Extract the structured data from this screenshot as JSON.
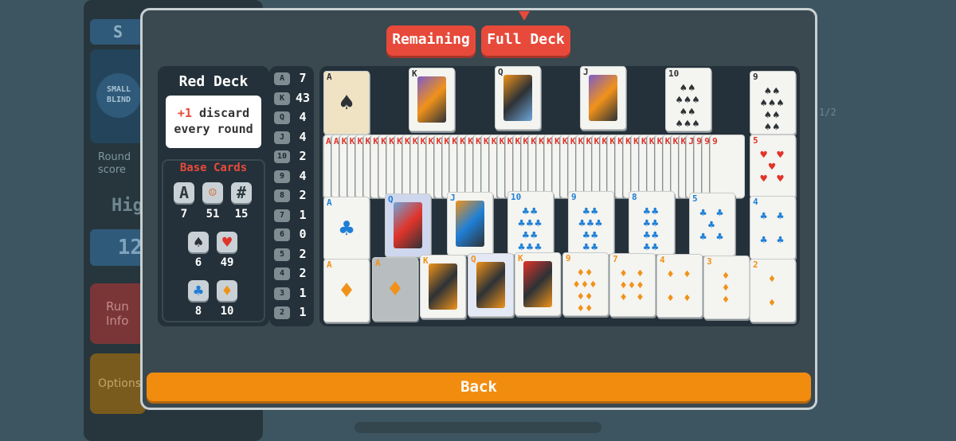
{
  "background": {
    "blind_header": "S",
    "small_blind": "SMALL BLIND",
    "round_score": "Round score",
    "high": "Hig",
    "score_value": "12",
    "run_info": "Run Info",
    "options": "Options",
    "page": "1/2"
  },
  "tabs": {
    "remaining": "Remaining",
    "full_deck": "Full Deck",
    "selected": "Full Deck"
  },
  "deck": {
    "title": "Red Deck",
    "bonus": "+1",
    "desc_1": "discard",
    "desc_2": "every round"
  },
  "base_cards": {
    "title": "Base Cards",
    "stats": [
      {
        "icon": "ace-icon",
        "glyph": "A",
        "count": "7"
      },
      {
        "icon": "face-card-icon",
        "glyph": "☺",
        "count": "51"
      },
      {
        "icon": "number-card-icon",
        "glyph": "#",
        "count": "15"
      },
      {
        "icon": "spade-icon",
        "glyph": "♠",
        "count": "6"
      },
      {
        "icon": "heart-icon",
        "glyph": "♥",
        "count": "49"
      },
      {
        "icon": "club-icon",
        "glyph": "♣",
        "count": "8"
      },
      {
        "icon": "diamond-icon",
        "glyph": "♦",
        "count": "10"
      }
    ]
  },
  "ranks": [
    {
      "rank": "A",
      "count": "7"
    },
    {
      "rank": "K",
      "count": "43"
    },
    {
      "rank": "Q",
      "count": "4"
    },
    {
      "rank": "J",
      "count": "4"
    },
    {
      "rank": "10",
      "count": "2"
    },
    {
      "rank": "9",
      "count": "4"
    },
    {
      "rank": "8",
      "count": "2"
    },
    {
      "rank": "7",
      "count": "1"
    },
    {
      "rank": "6",
      "count": "0"
    },
    {
      "rank": "5",
      "count": "2"
    },
    {
      "rank": "4",
      "count": "2"
    },
    {
      "rank": "3",
      "count": "1"
    },
    {
      "rank": "2",
      "count": "1"
    }
  ],
  "cards": {
    "spades": [
      "A",
      "K",
      "Q",
      "J",
      "10",
      "9"
    ],
    "hearts_fan_ranks": [
      "A",
      "A",
      "K",
      "J",
      "9",
      "5"
    ],
    "clubs": [
      "A",
      "Q",
      "J",
      "10",
      "9",
      "8",
      "5",
      "4"
    ],
    "diamonds": [
      "A",
      "A",
      "K",
      "Q",
      "K",
      "9",
      "7",
      "4",
      "3",
      "2"
    ]
  },
  "back": "Back",
  "colors": {
    "accent_red": "#e74a3a",
    "accent_orange": "#f28c0f",
    "spade": "#2d3236",
    "heart": "#e0342a",
    "club": "#1f7fd6",
    "diamond": "#f0921a"
  }
}
